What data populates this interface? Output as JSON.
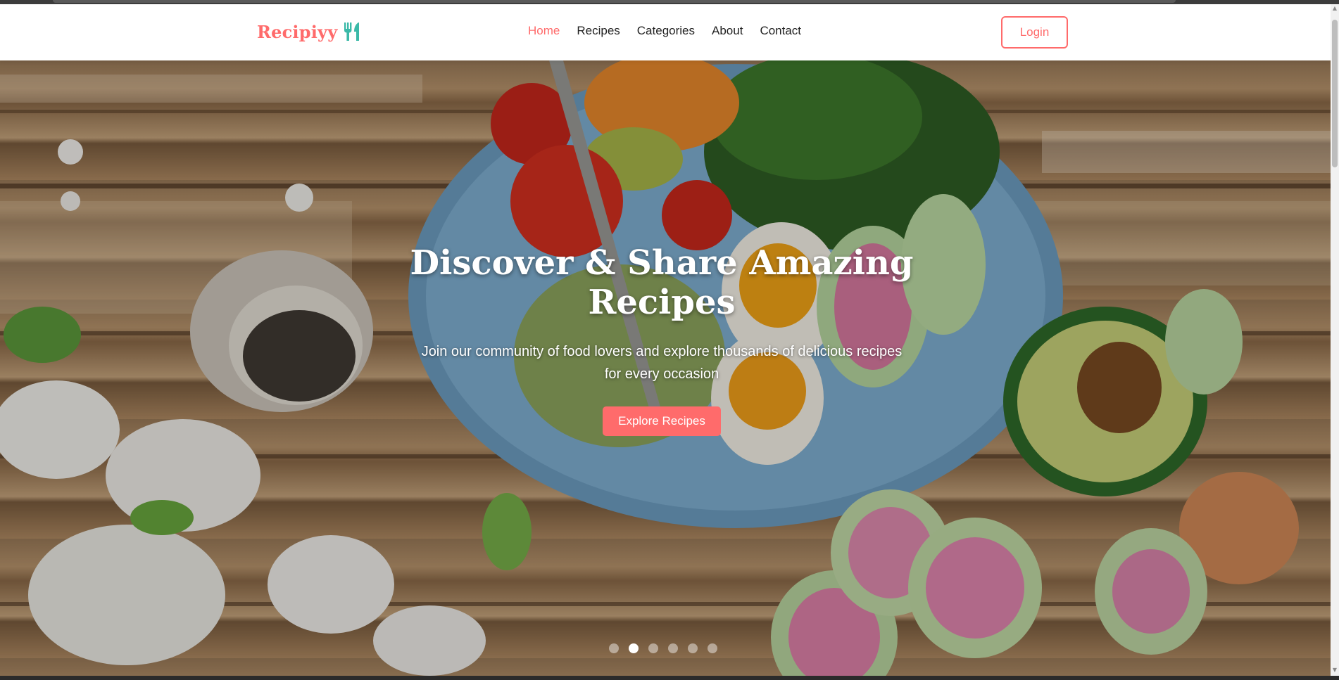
{
  "brand": {
    "name": "Recipiyy",
    "icon": "utensils-icon",
    "color": "#ff6b6b"
  },
  "nav": {
    "links": [
      {
        "label": "Home",
        "active": true
      },
      {
        "label": "Recipes",
        "active": false
      },
      {
        "label": "Categories",
        "active": false
      },
      {
        "label": "About",
        "active": false
      },
      {
        "label": "Contact",
        "active": false
      }
    ],
    "login_label": "Login"
  },
  "hero": {
    "title": "Discover & Share Amazing Recipes",
    "subtitle": "Join our community of food lovers and explore thousands of delicious recipes for every occasion",
    "cta_label": "Explore Recipes",
    "slides_total": 6,
    "active_slide": 2
  },
  "colors": {
    "accent": "#ff6b6b",
    "nav_text": "#222222",
    "hero_text": "#ffffff"
  }
}
